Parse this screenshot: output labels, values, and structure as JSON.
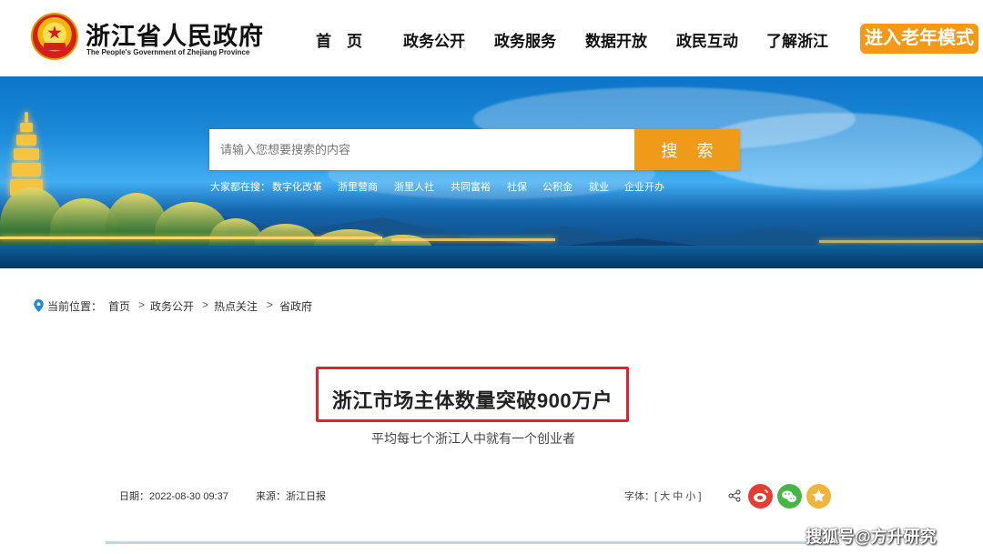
{
  "header": {
    "title": "浙江省人民政府",
    "subtitle": "The People's Government of Zhejiang Province",
    "nav_items": [
      {
        "label": "首　页"
      },
      {
        "label": "政务公开"
      },
      {
        "label": "政务服务"
      },
      {
        "label": "数据开放"
      },
      {
        "label": "政民互动"
      },
      {
        "label": "了解浙江"
      }
    ],
    "elder_mode_label": "进入老年模式"
  },
  "search": {
    "placeholder": "请输入您想要搜索的内容",
    "button_label": "搜 索",
    "hot_label": "大家都在搜：",
    "hot_items": [
      {
        "label": "数字化改革"
      },
      {
        "label": "浙里营商"
      },
      {
        "label": "浙里人社"
      },
      {
        "label": "共同富裕"
      },
      {
        "label": "社保"
      },
      {
        "label": "公积金"
      },
      {
        "label": "就业"
      },
      {
        "label": "企业开办"
      }
    ]
  },
  "breadcrumb": {
    "label": "当前位置：",
    "items": [
      {
        "label": "首页"
      },
      {
        "label": "政务公开"
      },
      {
        "label": "热点关注"
      },
      {
        "label": "省政府"
      }
    ],
    "separator": ">"
  },
  "article": {
    "title": "浙江市场主体数量突破900万户",
    "subtitle": "平均每七个浙江人中就有一个创业者",
    "date_label": "日期：",
    "date_value": "2022-08-30 09:37",
    "source_label": "来源：",
    "source_value": "浙江日报",
    "font_size_label": "字体：[",
    "font_size_options": [
      "大",
      "中",
      "小"
    ],
    "font_size_end": "]"
  },
  "share": {
    "icons": [
      "share-icon",
      "weibo-icon",
      "wechat-icon",
      "favorite-icon"
    ]
  },
  "watermark": {
    "text": "搜狐号@方升研究"
  },
  "colors": {
    "accent_orange": "#f29a18",
    "title_outline_red": "#e2212b",
    "weibo_red": "#e43d31",
    "wechat_green": "#48b646",
    "favorite_yellow": "#f0b43a"
  }
}
